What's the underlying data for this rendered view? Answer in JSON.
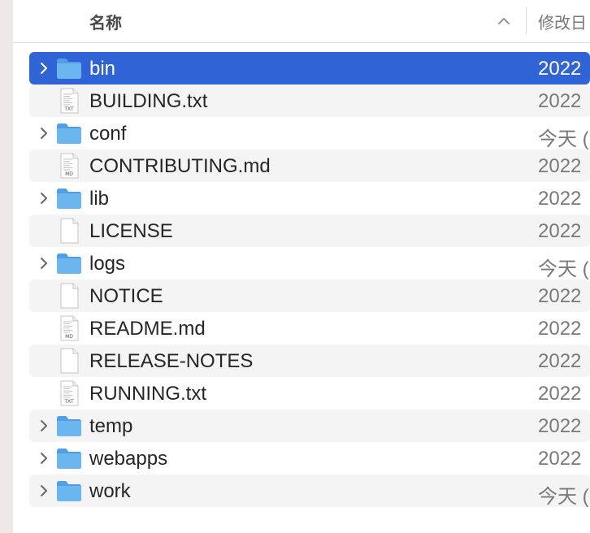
{
  "header": {
    "name_label": "名称",
    "date_label": "修改日",
    "sort_icon": "chevron-up-icon"
  },
  "colors": {
    "selection": "#2f63d6",
    "folder": "#6bb6ef",
    "stripe": "#f4f4f4"
  },
  "files": [
    {
      "name": "bin",
      "kind": "folder",
      "date": "2022",
      "selected": true
    },
    {
      "name": "BUILDING.txt",
      "kind": "txt",
      "date": "2022"
    },
    {
      "name": "conf",
      "kind": "folder",
      "date": "今天 ("
    },
    {
      "name": "CONTRIBUTING.md",
      "kind": "md",
      "date": "2022"
    },
    {
      "name": "lib",
      "kind": "folder",
      "date": "2022"
    },
    {
      "name": "LICENSE",
      "kind": "blank",
      "date": "2022"
    },
    {
      "name": "logs",
      "kind": "folder",
      "date": "今天 ("
    },
    {
      "name": "NOTICE",
      "kind": "blank",
      "date": "2022"
    },
    {
      "name": "README.md",
      "kind": "md",
      "date": "2022"
    },
    {
      "name": "RELEASE-NOTES",
      "kind": "blank",
      "date": "2022"
    },
    {
      "name": "RUNNING.txt",
      "kind": "txt",
      "date": "2022"
    },
    {
      "name": "temp",
      "kind": "folder",
      "date": "2022"
    },
    {
      "name": "webapps",
      "kind": "folder",
      "date": "2022"
    },
    {
      "name": "work",
      "kind": "folder",
      "date": "今天 ("
    }
  ]
}
